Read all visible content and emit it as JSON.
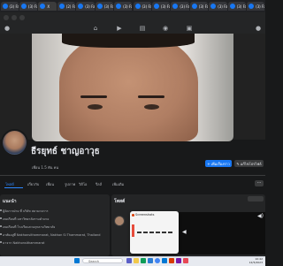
{
  "browser": {
    "tabs": [
      {
        "label": "(3) Fa"
      },
      {
        "label": "(3) Fa"
      },
      {
        "label": "X"
      },
      {
        "label": "(2) Fa"
      },
      {
        "label": "(3) Fa"
      },
      {
        "label": "(3) Fa"
      },
      {
        "label": "(3) Fa"
      },
      {
        "label": "(3) Fa"
      },
      {
        "label": "(3) Fa"
      },
      {
        "label": "(3) Fa"
      },
      {
        "label": "(3) Fa"
      },
      {
        "label": "(3) Fa"
      },
      {
        "label": "(3) Fa"
      },
      {
        "label": "(3) Fa"
      }
    ]
  },
  "profile": {
    "name": "ธีรยุทธ์ ชาญอาวุธ",
    "friends": "เพื่อน 1.5 พัน คน",
    "primary_button": "เพิ่มเรื่องราว",
    "secondary_button": "แก้ไขโปรไฟล์",
    "tabs": [
      "โพสต์",
      "เกี่ยวกับ",
      "เพื่อน",
      "รูปภาพ",
      "วิดีโอ",
      "รีลส์",
      "เพิ่มเติม"
    ],
    "more": "···"
  },
  "intro": {
    "title": "แนะนำ",
    "rows": [
      "ผู้จัดการฝ่าย ที่ บริษัท สยามกลการ",
      "เคยเรียนที่ มหาวิทยาลัยรามคำแหง",
      "เคยเรียนที่ โรงเรียนสวนกุหลาบวิทยาลัย",
      "อาศัยอยู่ที่ Nakhonsithammarat, Nakhon Si Thammarat, Thailand",
      "มาจาก Nakhonsithammarat"
    ]
  },
  "posts": {
    "title": "โพสต์"
  },
  "screenshot_popup": {
    "title": "Screenshots"
  },
  "taskbar": {
    "search_placeholder": "Search",
    "time": "10:42",
    "date": "12/5/2023"
  },
  "colors": {
    "accent": "#1877f2",
    "background": "#18191a",
    "card": "#242526"
  }
}
